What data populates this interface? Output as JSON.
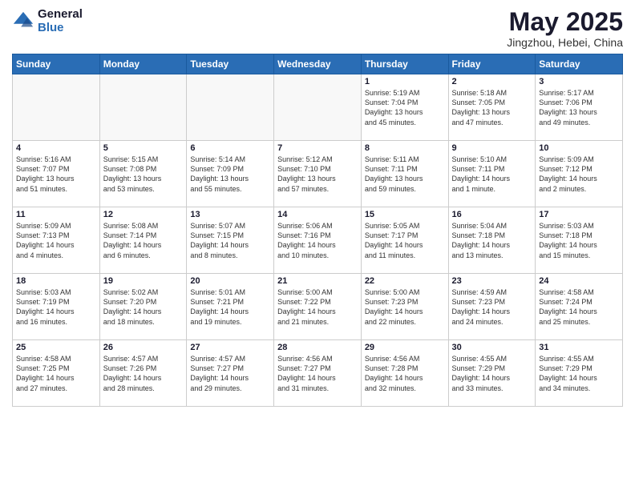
{
  "header": {
    "logo_general": "General",
    "logo_blue": "Blue",
    "month_title": "May 2025",
    "location": "Jingzhou, Hebei, China"
  },
  "weekdays": [
    "Sunday",
    "Monday",
    "Tuesday",
    "Wednesday",
    "Thursday",
    "Friday",
    "Saturday"
  ],
  "weeks": [
    [
      {
        "day": "",
        "info": ""
      },
      {
        "day": "",
        "info": ""
      },
      {
        "day": "",
        "info": ""
      },
      {
        "day": "",
        "info": ""
      },
      {
        "day": "1",
        "info": "Sunrise: 5:19 AM\nSunset: 7:04 PM\nDaylight: 13 hours\nand 45 minutes."
      },
      {
        "day": "2",
        "info": "Sunrise: 5:18 AM\nSunset: 7:05 PM\nDaylight: 13 hours\nand 47 minutes."
      },
      {
        "day": "3",
        "info": "Sunrise: 5:17 AM\nSunset: 7:06 PM\nDaylight: 13 hours\nand 49 minutes."
      }
    ],
    [
      {
        "day": "4",
        "info": "Sunrise: 5:16 AM\nSunset: 7:07 PM\nDaylight: 13 hours\nand 51 minutes."
      },
      {
        "day": "5",
        "info": "Sunrise: 5:15 AM\nSunset: 7:08 PM\nDaylight: 13 hours\nand 53 minutes."
      },
      {
        "day": "6",
        "info": "Sunrise: 5:14 AM\nSunset: 7:09 PM\nDaylight: 13 hours\nand 55 minutes."
      },
      {
        "day": "7",
        "info": "Sunrise: 5:12 AM\nSunset: 7:10 PM\nDaylight: 13 hours\nand 57 minutes."
      },
      {
        "day": "8",
        "info": "Sunrise: 5:11 AM\nSunset: 7:11 PM\nDaylight: 13 hours\nand 59 minutes."
      },
      {
        "day": "9",
        "info": "Sunrise: 5:10 AM\nSunset: 7:11 PM\nDaylight: 14 hours\nand 1 minute."
      },
      {
        "day": "10",
        "info": "Sunrise: 5:09 AM\nSunset: 7:12 PM\nDaylight: 14 hours\nand 2 minutes."
      }
    ],
    [
      {
        "day": "11",
        "info": "Sunrise: 5:09 AM\nSunset: 7:13 PM\nDaylight: 14 hours\nand 4 minutes."
      },
      {
        "day": "12",
        "info": "Sunrise: 5:08 AM\nSunset: 7:14 PM\nDaylight: 14 hours\nand 6 minutes."
      },
      {
        "day": "13",
        "info": "Sunrise: 5:07 AM\nSunset: 7:15 PM\nDaylight: 14 hours\nand 8 minutes."
      },
      {
        "day": "14",
        "info": "Sunrise: 5:06 AM\nSunset: 7:16 PM\nDaylight: 14 hours\nand 10 minutes."
      },
      {
        "day": "15",
        "info": "Sunrise: 5:05 AM\nSunset: 7:17 PM\nDaylight: 14 hours\nand 11 minutes."
      },
      {
        "day": "16",
        "info": "Sunrise: 5:04 AM\nSunset: 7:18 PM\nDaylight: 14 hours\nand 13 minutes."
      },
      {
        "day": "17",
        "info": "Sunrise: 5:03 AM\nSunset: 7:18 PM\nDaylight: 14 hours\nand 15 minutes."
      }
    ],
    [
      {
        "day": "18",
        "info": "Sunrise: 5:03 AM\nSunset: 7:19 PM\nDaylight: 14 hours\nand 16 minutes."
      },
      {
        "day": "19",
        "info": "Sunrise: 5:02 AM\nSunset: 7:20 PM\nDaylight: 14 hours\nand 18 minutes."
      },
      {
        "day": "20",
        "info": "Sunrise: 5:01 AM\nSunset: 7:21 PM\nDaylight: 14 hours\nand 19 minutes."
      },
      {
        "day": "21",
        "info": "Sunrise: 5:00 AM\nSunset: 7:22 PM\nDaylight: 14 hours\nand 21 minutes."
      },
      {
        "day": "22",
        "info": "Sunrise: 5:00 AM\nSunset: 7:23 PM\nDaylight: 14 hours\nand 22 minutes."
      },
      {
        "day": "23",
        "info": "Sunrise: 4:59 AM\nSunset: 7:23 PM\nDaylight: 14 hours\nand 24 minutes."
      },
      {
        "day": "24",
        "info": "Sunrise: 4:58 AM\nSunset: 7:24 PM\nDaylight: 14 hours\nand 25 minutes."
      }
    ],
    [
      {
        "day": "25",
        "info": "Sunrise: 4:58 AM\nSunset: 7:25 PM\nDaylight: 14 hours\nand 27 minutes."
      },
      {
        "day": "26",
        "info": "Sunrise: 4:57 AM\nSunset: 7:26 PM\nDaylight: 14 hours\nand 28 minutes."
      },
      {
        "day": "27",
        "info": "Sunrise: 4:57 AM\nSunset: 7:27 PM\nDaylight: 14 hours\nand 29 minutes."
      },
      {
        "day": "28",
        "info": "Sunrise: 4:56 AM\nSunset: 7:27 PM\nDaylight: 14 hours\nand 31 minutes."
      },
      {
        "day": "29",
        "info": "Sunrise: 4:56 AM\nSunset: 7:28 PM\nDaylight: 14 hours\nand 32 minutes."
      },
      {
        "day": "30",
        "info": "Sunrise: 4:55 AM\nSunset: 7:29 PM\nDaylight: 14 hours\nand 33 minutes."
      },
      {
        "day": "31",
        "info": "Sunrise: 4:55 AM\nSunset: 7:29 PM\nDaylight: 14 hours\nand 34 minutes."
      }
    ]
  ]
}
